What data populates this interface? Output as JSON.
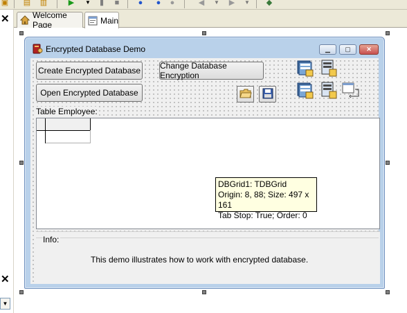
{
  "tabs": [
    {
      "label": "Welcome Page",
      "icon": "house-icon"
    },
    {
      "label": "Main",
      "icon": "form-icon"
    }
  ],
  "form": {
    "title": "Encrypted Database Demo",
    "buttons": {
      "create": "Create Encrypted Database",
      "change": "Change Database Encryption",
      "open": "Open Encrypted Database"
    },
    "table_label": "Table Employee:",
    "info_label": "Info:",
    "info_text": "This demo illustrates how to work with encrypted database."
  },
  "tooltip": {
    "line1": "DBGrid1: TDBGrid",
    "line2": "Origin: 8, 88; Size: 497 x 161",
    "line3": "Tab Stop: True; Order: 0"
  },
  "colors": {
    "titlebar": "#b9d1ea",
    "close_button": "#c75050",
    "tooltip_bg": "#ffffe1"
  }
}
